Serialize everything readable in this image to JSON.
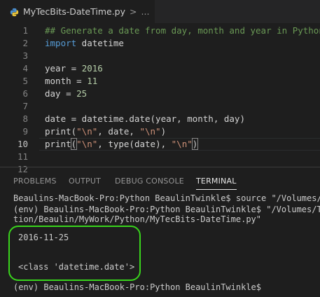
{
  "tab": {
    "filename": "MyTecBits-DateTime.py",
    "separator": ">",
    "breadcrumb": "..."
  },
  "editor": {
    "lines": [
      {
        "num": "1",
        "parts": [
          {
            "t": "## Generate a date from day, month and year in Python",
            "c": "cm"
          }
        ]
      },
      {
        "num": "2",
        "parts": [
          {
            "t": "import",
            "c": "kw"
          },
          {
            "t": " datetime",
            "c": ""
          }
        ]
      },
      {
        "num": "3",
        "parts": []
      },
      {
        "num": "4",
        "parts": [
          {
            "t": "year = ",
            "c": ""
          },
          {
            "t": "2016",
            "c": "num"
          }
        ]
      },
      {
        "num": "5",
        "parts": [
          {
            "t": "month = ",
            "c": ""
          },
          {
            "t": "11",
            "c": "num"
          }
        ]
      },
      {
        "num": "6",
        "parts": [
          {
            "t": "day = ",
            "c": ""
          },
          {
            "t": "25",
            "c": "num"
          }
        ]
      },
      {
        "num": "7",
        "parts": []
      },
      {
        "num": "8",
        "parts": [
          {
            "t": "date = datetime.date(year, month, day)",
            "c": ""
          }
        ]
      },
      {
        "num": "9",
        "parts": [
          {
            "t": "print(",
            "c": ""
          },
          {
            "t": "\"\\n\"",
            "c": "str"
          },
          {
            "t": ", date, ",
            "c": ""
          },
          {
            "t": "\"\\n\"",
            "c": "str"
          },
          {
            "t": ")",
            "c": ""
          }
        ]
      },
      {
        "num": "10",
        "current": true,
        "parts": [
          {
            "t": "print",
            "c": ""
          },
          {
            "t": "(",
            "c": "bracket"
          },
          {
            "t": "\"\\n\"",
            "c": "str"
          },
          {
            "t": ", type(date), ",
            "c": ""
          },
          {
            "t": "\"\\n\"",
            "c": "str"
          },
          {
            "t": ")",
            "c": "bracket"
          }
        ]
      },
      {
        "num": "11",
        "parts": []
      },
      {
        "num": "12",
        "parts": []
      }
    ]
  },
  "panel": {
    "tabs": [
      "PROBLEMS",
      "OUTPUT",
      "DEBUG CONSOLE",
      "TERMINAL"
    ],
    "active_tab": "TERMINAL",
    "terminal_lines": [
      "Beaulins-MacBook-Pro:Python BeaulinTwinkle$ source \"/Volumes/Tr",
      "(env) Beaulins-MacBook-Pro:Python BeaulinTwinkle$ \"/Volumes/Tra",
      "tion/Beaulin/MyWork/Python/MyTecBits-DateTime.py\"",
      "",
      "2016-11-25",
      "",
      "",
      "<class 'datetime.date'>",
      "",
      "(env) Beaulins-MacBook-Pro:Python BeaulinTwinkle$"
    ]
  },
  "colors": {
    "highlight_box": "#39d41c",
    "background": "#1e1e1e"
  }
}
